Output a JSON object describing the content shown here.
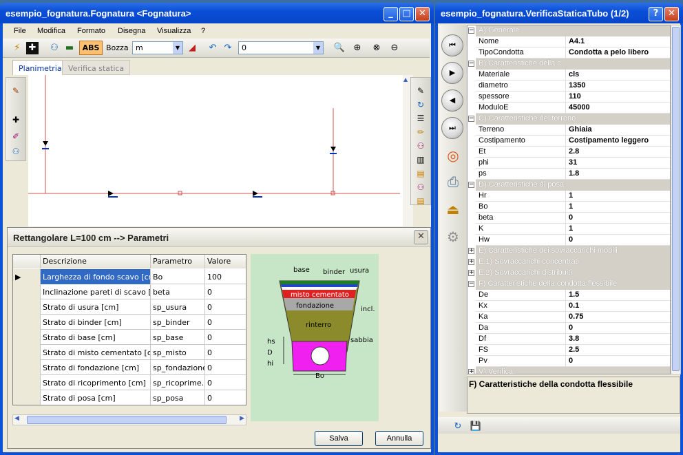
{
  "main_window": {
    "title": "esempio_fognatura.Fognatura <Fognatura>",
    "menu": [
      "File",
      "Modifica",
      "Formato",
      "Disegna",
      "Visualizza",
      "?"
    ],
    "toolbar": {
      "abs_label": "ABS",
      "bozza_label": "Bozza",
      "unit_value": "m",
      "number_value": "0"
    },
    "tabs": [
      "Planimetria",
      "Verifica statica"
    ]
  },
  "dialog": {
    "title": "Rettangolare L=100 cm --> Parametri",
    "columns": [
      "Descrizione",
      "Parametro",
      "Valore"
    ],
    "rows": [
      {
        "descrizione": "Larghezza di fondo scavo [cm]",
        "parametro": "Bo",
        "valore": "100"
      },
      {
        "descrizione": "Inclinazione pareti di scavo [gr...",
        "parametro": "beta",
        "valore": "0"
      },
      {
        "descrizione": "Strato di usura [cm]",
        "parametro": "sp_usura",
        "valore": "0"
      },
      {
        "descrizione": "Strato di binder [cm]",
        "parametro": "sp_binder",
        "valore": "0"
      },
      {
        "descrizione": "Strato di base [cm]",
        "parametro": "sp_base",
        "valore": "0"
      },
      {
        "descrizione": "Strato di misto cementato [cm]",
        "parametro": "sp_misto",
        "valore": "0"
      },
      {
        "descrizione": "Strato di fondazione [cm]",
        "parametro": "sp_fondazione",
        "valore": "0"
      },
      {
        "descrizione": "Strato di ricoprimento [cm]",
        "parametro": "sp_ricoprime...",
        "valore": "0"
      },
      {
        "descrizione": "Strato di posa [cm]",
        "parametro": "sp_posa",
        "valore": "0"
      }
    ],
    "diagram_labels": {
      "base": "base",
      "binder": "binder",
      "usura": "usura",
      "misto": "misto cementato",
      "fondazione": "fondazione",
      "rinterro": "rinterro",
      "incl": "incl.",
      "sabbia": "sabbia",
      "hs": "hs",
      "d": "D",
      "hi": "hi",
      "bo": "Bo"
    },
    "save_label": "Salva",
    "cancel_label": "Annulla"
  },
  "props_window": {
    "title": "esempio_fognatura.VerificaStaticaTubo (1/2)",
    "rows": [
      {
        "type": "cat",
        "exp": "−",
        "label": "A) Generale"
      },
      {
        "type": "prop",
        "name": "Nome",
        "value": "A4.1"
      },
      {
        "type": "prop",
        "name": "TipoCondotta",
        "value": "Condotta a pelo libero"
      },
      {
        "type": "cat",
        "exp": "−",
        "label": "B) Caratteristiche della c"
      },
      {
        "type": "prop",
        "name": "Materiale",
        "value": "cls"
      },
      {
        "type": "prop",
        "name": "diametro",
        "value": "1350"
      },
      {
        "type": "prop",
        "name": "spessore",
        "value": "110"
      },
      {
        "type": "prop",
        "name": "ModuloE",
        "value": "45000"
      },
      {
        "type": "cat",
        "exp": "−",
        "label": "C) Caratteristiche del terreno"
      },
      {
        "type": "prop",
        "name": "Terreno",
        "value": "Ghiaia"
      },
      {
        "type": "prop",
        "name": "Costipamento",
        "value": "Costipamento leggero"
      },
      {
        "type": "prop",
        "name": "Et",
        "value": "2.8"
      },
      {
        "type": "prop",
        "name": "phi",
        "value": "31"
      },
      {
        "type": "prop",
        "name": "ps",
        "value": "1.8"
      },
      {
        "type": "cat",
        "exp": "−",
        "label": "D) Caratteristiche di posa"
      },
      {
        "type": "prop",
        "name": "Hr",
        "value": "1"
      },
      {
        "type": "prop",
        "name": "Bo",
        "value": "1"
      },
      {
        "type": "prop",
        "name": "beta",
        "value": "0"
      },
      {
        "type": "prop",
        "name": "K",
        "value": "1"
      },
      {
        "type": "prop",
        "name": "Hw",
        "value": "0"
      },
      {
        "type": "cat",
        "exp": "+",
        "label": "E) Caratteristiche dei sovraccarichi mobili"
      },
      {
        "type": "cat",
        "exp": "+",
        "label": "E.1) Sovraccarichi concentrati"
      },
      {
        "type": "cat",
        "exp": "+",
        "label": "E.2) Sovraccarichi distribuiti"
      },
      {
        "type": "cat",
        "exp": "−",
        "label": "F) Caratteristiche della condotta flessibile"
      },
      {
        "type": "prop",
        "name": "De",
        "value": "1.5"
      },
      {
        "type": "prop",
        "name": "Kx",
        "value": "0.1"
      },
      {
        "type": "prop",
        "name": "Ka",
        "value": "0.75"
      },
      {
        "type": "prop",
        "name": "Da",
        "value": "0"
      },
      {
        "type": "prop",
        "name": "Df",
        "value": "3.8"
      },
      {
        "type": "prop",
        "name": "FS",
        "value": "2.5"
      },
      {
        "type": "prop",
        "name": "Pv",
        "value": "0"
      },
      {
        "type": "cat",
        "exp": "+",
        "label": "V) Verifica"
      }
    ],
    "description": "F) Caratteristiche della condotta flessibile"
  }
}
